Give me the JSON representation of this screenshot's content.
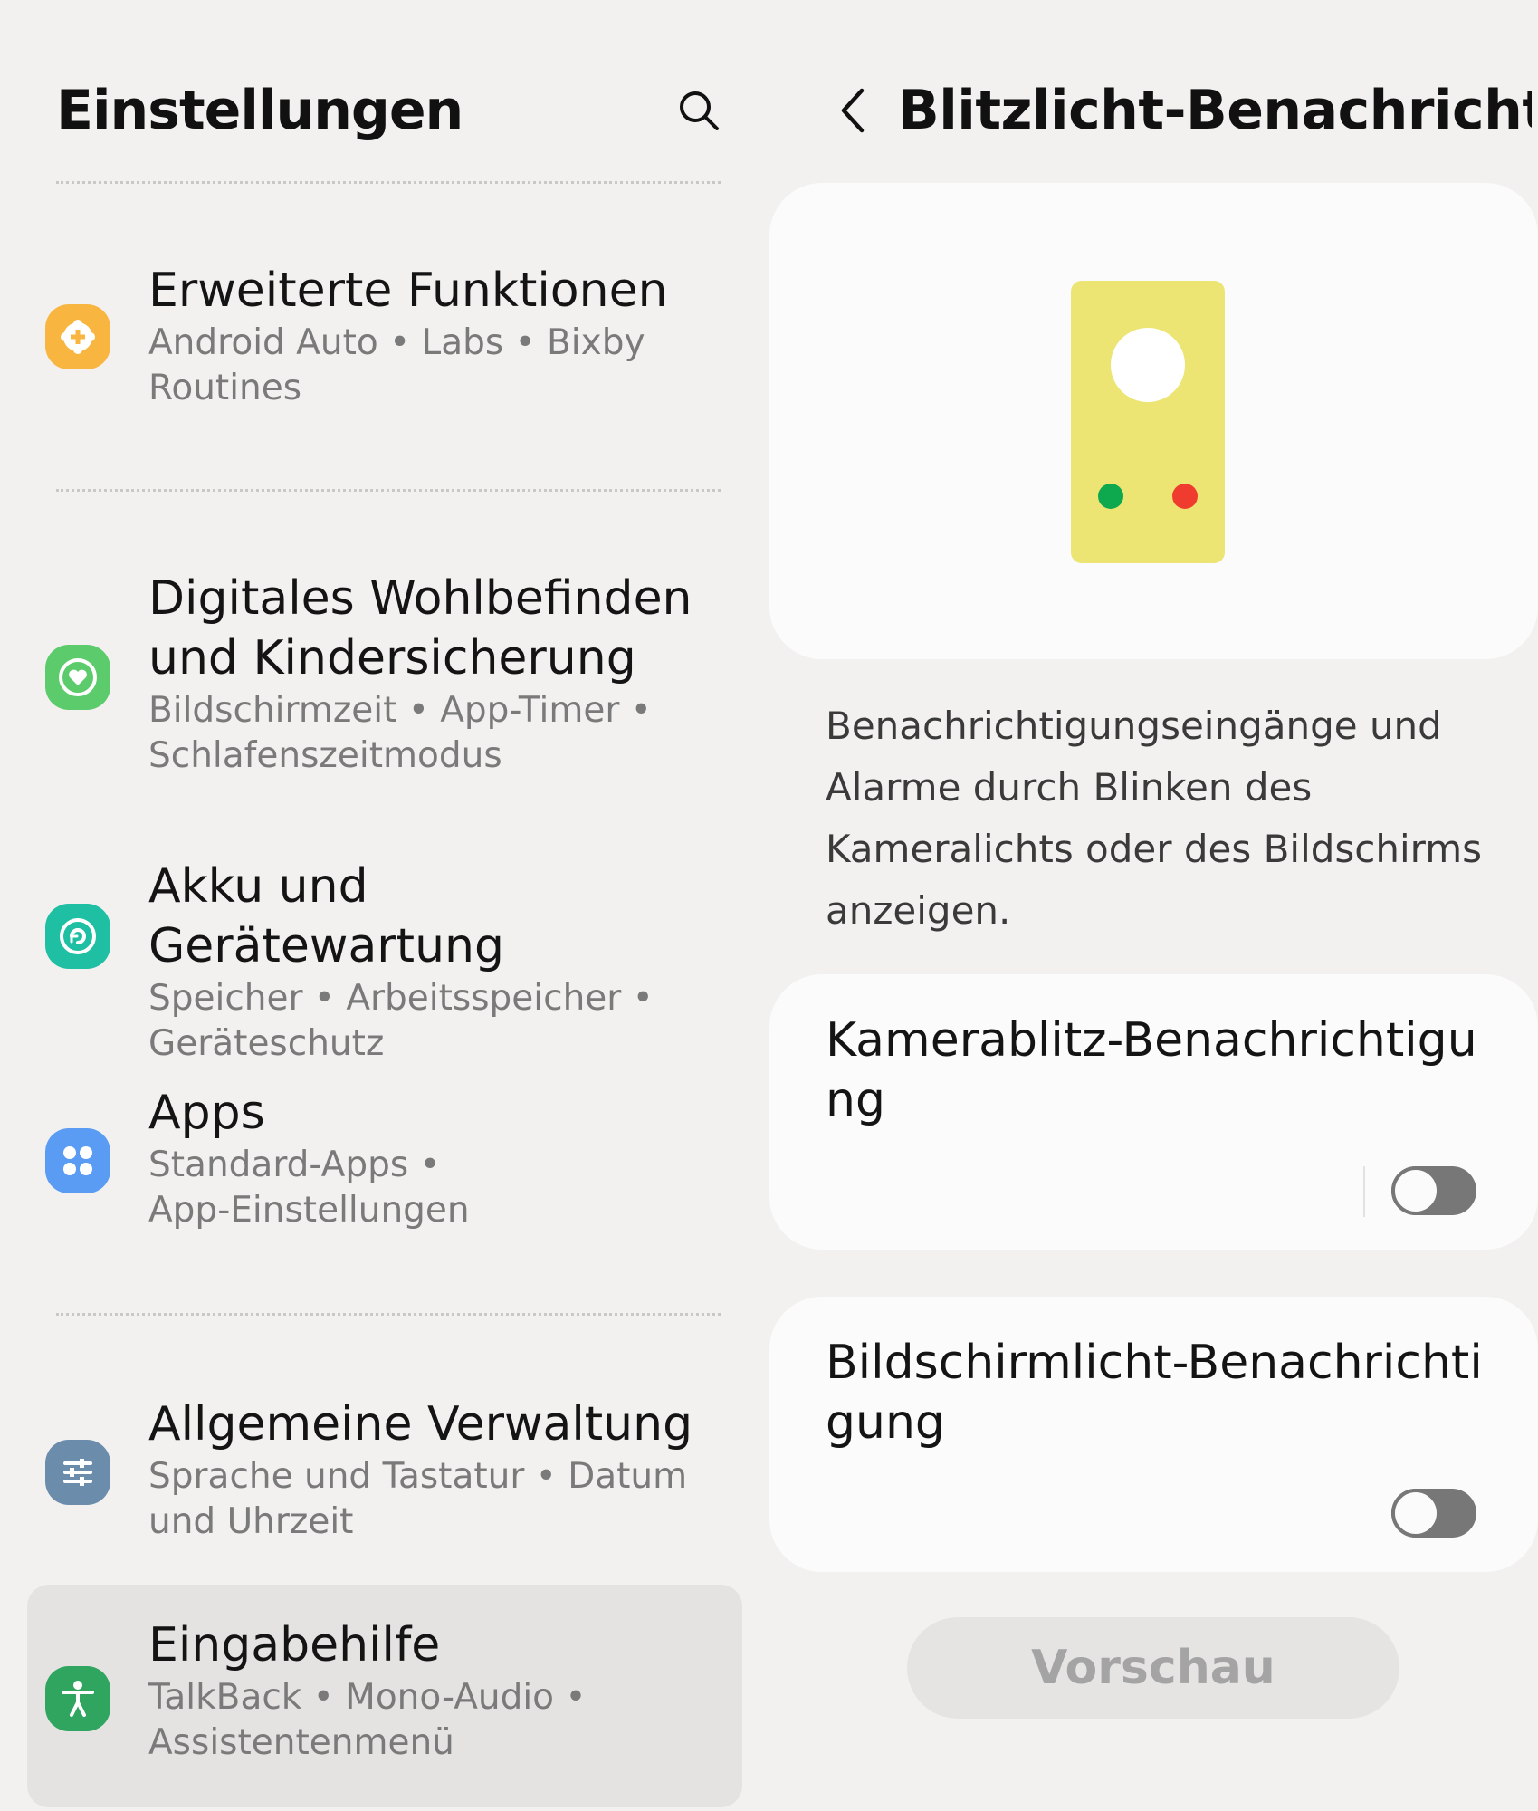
{
  "left": {
    "title": "Einstellungen",
    "search_icon": "search-icon",
    "items": [
      {
        "title": "Erweiterte Funktionen",
        "sub1": "Android Auto  •  Labs  •  Bixby",
        "sub2": "Routines",
        "icon": "gear-plus-icon",
        "color": "#f8b640"
      },
      {
        "title1": "Digitales Wohlbefinden",
        "title2": "und Kindersicherung",
        "sub1": "Bildschirmzeit  •  App-Timer  •",
        "sub2": "Schlafenszeitmodus",
        "icon": "heart-circle-icon",
        "color": "#5ccb6c"
      },
      {
        "title": "Akku und Gerätewartung",
        "sub1": "Speicher  •  Arbeitsspeicher  •",
        "sub2": "Geräteschutz",
        "icon": "device-care-icon",
        "color": "#1fbfa3"
      },
      {
        "title": "Apps",
        "sub1": "Standard-Apps  •",
        "sub2": "App-Einstellungen",
        "icon": "apps-grid-icon",
        "color": "#5a9cf4"
      },
      {
        "title": "Allgemeine Verwaltung",
        "sub1": "Sprache und Tastatur  •  Datum",
        "sub2": "und Uhrzeit",
        "icon": "sliders-icon",
        "color": "#6b8cab"
      },
      {
        "title": "Eingabehilfe",
        "sub1": "TalkBack  •  Mono-Audio  •",
        "sub2": "Assistentenmenü",
        "icon": "accessibility-icon",
        "color": "#2fa560"
      }
    ]
  },
  "right": {
    "title": "Blitzlicht-Benachrichti...",
    "back_icon": "chevron-left-icon",
    "description": "Benachrichtigungseingänge und Alarme durch Blinken des Kameralichts oder des Bildschirms anzeigen.",
    "toggles": [
      {
        "label": "Kamerablitz-Benachrichtigung",
        "state": "off"
      },
      {
        "label": "Bildschirmlicht-Benachrichtigung",
        "state": "off"
      }
    ],
    "preview_label": "Vorschau"
  }
}
